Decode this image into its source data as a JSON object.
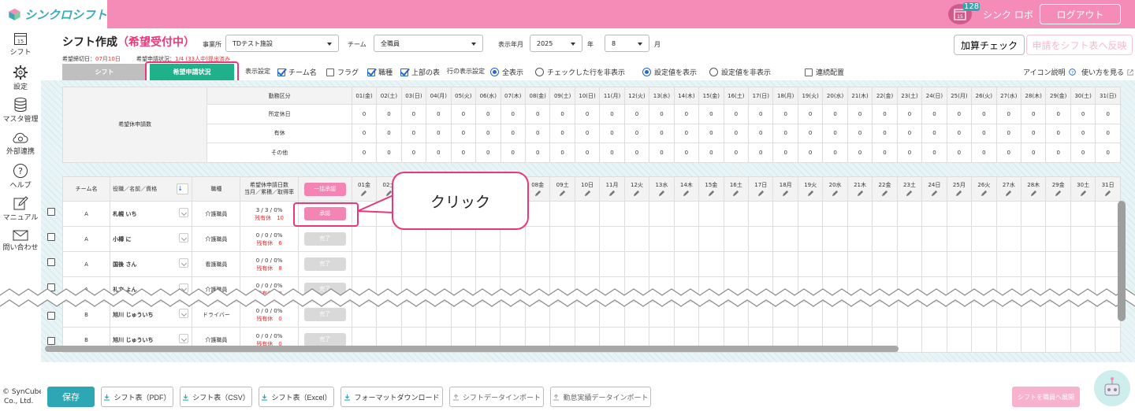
{
  "app": {
    "logo_text": "シンクロシフト",
    "notification_count": "128",
    "calendar_day": "15",
    "user_name": "シンク ロボ",
    "logout_label": "ログアウト"
  },
  "sidebar": {
    "items": [
      {
        "label": "シフト",
        "icon": "calendar-icon",
        "day": "15"
      },
      {
        "label": "設定",
        "icon": "gear-icon"
      },
      {
        "label": "マスタ管理",
        "icon": "database-icon"
      },
      {
        "label": "外部連携",
        "icon": "cloud-sync-icon"
      },
      {
        "label": "ヘルプ",
        "icon": "help-icon"
      },
      {
        "label": "マニュアル",
        "icon": "edit-icon"
      },
      {
        "label": "問い合わせ",
        "icon": "mail-icon"
      }
    ],
    "copyright_line1": "© SynCube",
    "copyright_line2": "Co., Ltd."
  },
  "header": {
    "title": "シフト作成",
    "title_status": "（希望受付中）",
    "facility_label": "事業所",
    "facility_value": "TDテスト施設",
    "team_label": "チーム",
    "team_value": "全職員",
    "year_month_label": "表示年月",
    "year_value": "2025",
    "year_unit": "年",
    "month_value": "8",
    "month_unit": "月",
    "check_button": "加算チェック",
    "apply_button": "申請をシフト表へ反映",
    "deadline_label": "希望締切日：",
    "deadline_value": "07月10日",
    "status_label": "希望申請状況：",
    "status_value": "1/4 (33人中)提出済み"
  },
  "tabs": [
    {
      "label": "シフト",
      "active": false
    },
    {
      "label": "希望申請状況",
      "active": true
    }
  ],
  "display_options": {
    "label": "表示設定",
    "checkboxes": [
      {
        "label": "チーム名",
        "checked": true
      },
      {
        "label": "フラグ",
        "checked": false
      },
      {
        "label": "職種",
        "checked": true
      },
      {
        "label": "上部の表",
        "checked": true
      }
    ],
    "row_display_label": "行の表示設定",
    "radios_rows": [
      {
        "label": "全表示",
        "checked": true
      },
      {
        "label": "チェックした行を非表示",
        "checked": false
      }
    ],
    "radios_values": [
      {
        "label": "設定値を表示",
        "checked": true
      },
      {
        "label": "設定値を非表示",
        "checked": false
      }
    ],
    "consecutive_label": "連続配置",
    "icon_help": "アイコン説明",
    "how_to": "使い方を見る"
  },
  "summary": {
    "group_label": "希望休申請数",
    "header_label": "勤務区分",
    "rows": [
      "所定休日",
      "有休",
      "その他"
    ],
    "days": [
      "01(金)",
      "02(土)",
      "03(日)",
      "04(月)",
      "05(火)",
      "06(水)",
      "07(木)",
      "08(金)",
      "09(土)",
      "10(日)",
      "11(月)",
      "12(火)",
      "13(水)",
      "14(木)",
      "15(金)",
      "16(土)",
      "17(日)",
      "18(月)",
      "19(火)",
      "20(水)",
      "21(木)",
      "22(金)",
      "23(土)",
      "24(日)",
      "25(月)",
      "26(火)",
      "27(水)",
      "28(木)",
      "29(金)",
      "30(土)",
      "31(日)"
    ],
    "value": "0"
  },
  "staff_table": {
    "col_team": "チーム名",
    "col_name": "役職／名前／資格",
    "col_job": "職種",
    "col_days_line1": "希望休申請日数",
    "col_days_line2": "当月／累積／取得率",
    "bulk_approve": "一括承認",
    "days": [
      "01金",
      "02土",
      "03日",
      "04月",
      "05火",
      "06水",
      "07木",
      "08金",
      "09土",
      "10日",
      "11月",
      "12火",
      "13水",
      "14木",
      "15金",
      "16土",
      "17日",
      "18月",
      "19火",
      "20水",
      "21木",
      "22金",
      "23土",
      "24日",
      "25月",
      "26火",
      "27水",
      "28木",
      "29金",
      "30土",
      "31日"
    ],
    "rows": [
      {
        "team": "A",
        "name": "札幌 いち",
        "job": "介護職員",
        "stats": "3 / 3 / 0%",
        "balance": "残有休　10",
        "action": "承認",
        "done": false
      },
      {
        "team": "A",
        "name": "小樽 に",
        "job": "介護職員",
        "stats": "0 / 0 / 0%",
        "balance": "残有休　6",
        "action": "完了",
        "done": true
      },
      {
        "team": "A",
        "name": "国後 さん",
        "job": "看護職員",
        "stats": "0 / 0 / 0%",
        "balance": "残有休　8",
        "action": "完了",
        "done": true
      },
      {
        "team": "A",
        "name": "礼文 よん",
        "job": "介護職員",
        "stats": "0 / 0 / 0%",
        "balance": "残有休　0",
        "action": "完了",
        "done": true
      },
      {
        "team": "B",
        "name": "旭川 じゅういち",
        "job": "ドライバー",
        "stats": "0 / 0 / 0%",
        "balance": "残有休　0",
        "action": "完了",
        "done": true
      },
      {
        "team": "B",
        "name": "旭川 じゅういち",
        "job": "介護職員",
        "stats": "0 / 0 / 0%",
        "balance": "残有休　0",
        "action": "完了",
        "done": true
      }
    ]
  },
  "callout": {
    "text": "クリック"
  },
  "footer": {
    "save": "保存",
    "buttons": [
      "シフト表（PDF）",
      "シフト表（CSV）",
      "シフト表（Excel）",
      "フォーマットダウンロード",
      "シフトデータインポート",
      "勤怠実績データインポート"
    ],
    "publish": "シフトを職員へ展開"
  },
  "colors": {
    "pink": "#f58cb7",
    "accent": "#e8387a",
    "teal": "#2ea7b5",
    "green": "#1fb189"
  }
}
